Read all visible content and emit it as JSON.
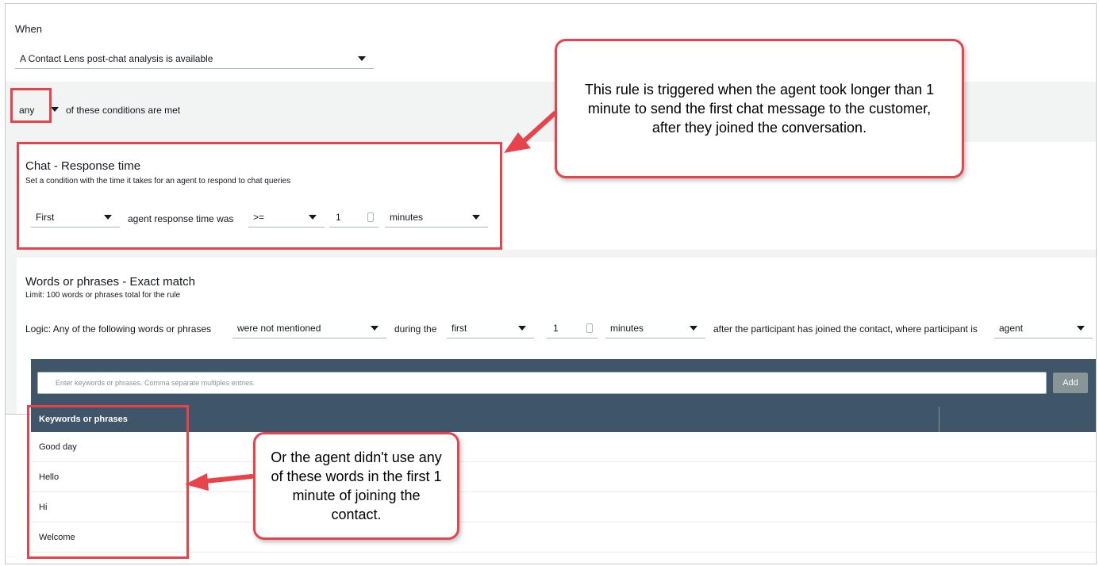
{
  "when": {
    "label": "When",
    "trigger_value": "A Contact Lens post-chat analysis is available"
  },
  "conditions": {
    "match_value": "any",
    "match_text": "of these conditions are met"
  },
  "response_time_card": {
    "title": "Chat - Response time",
    "subtitle": "Set a condition with the time it takes for an agent to respond to chat queries",
    "position_value": "First",
    "middle_text": "agent response time was",
    "operator_value": ">=",
    "amount_value": "1",
    "unit_value": "minutes"
  },
  "words_card": {
    "title": "Words or phrases - Exact match",
    "subtitle": "Limit: 100 words or phrases total for the rule",
    "logic_text": "Logic: Any of the following words or phrases",
    "mention_value": "were not mentioned",
    "during_text": "during the",
    "period_value": "first",
    "amount_value": "1",
    "unit_value": "minutes",
    "after_text": "after the participant has joined the contact, where participant is",
    "participant_value": "agent",
    "input_placeholder": "Enter keywords or phrases. Comma separate multiples entries.",
    "add_label": "Add",
    "column_header": "Keywords or phrases",
    "keywords": [
      "Good day",
      "Hello",
      "Hi",
      "Welcome"
    ]
  },
  "callouts": {
    "top": "This rule is triggered when the agent took longer than 1 minute to send the first chat message to the customer, after they joined the conversation.",
    "bottom": "Or the agent didn't use any of these words in the first 1 minute of joining the contact."
  },
  "colors": {
    "annotation_red": "#e8434a",
    "table_header": "#3f5569",
    "band_grey": "#f2f3f3"
  }
}
